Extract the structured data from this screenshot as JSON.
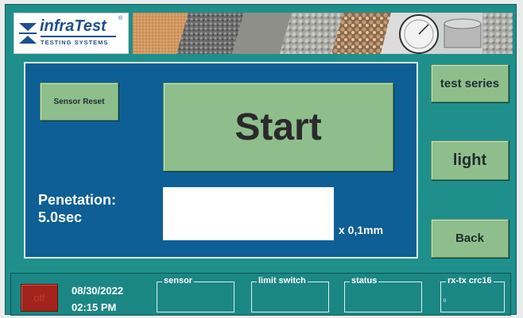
{
  "header": {
    "logo_name": "infraTest",
    "logo_registered": "®",
    "logo_tagline": "TESTING SYSTEMS"
  },
  "main": {
    "sensor_reset_label": "Sensor Reset",
    "start_label": "Start",
    "penetration_label": "Penetation:",
    "penetration_value": "5.0sec",
    "value_field": "",
    "unit_label": "x 0,1mm"
  },
  "side": {
    "test_series_label": "test series",
    "light_label": "light",
    "back_label": "Back"
  },
  "status_bar": {
    "off_label": "off",
    "date": "08/30/2022",
    "time": "02:15 PM",
    "groups": [
      {
        "label": "sensor",
        "value": ""
      },
      {
        "label": "limit switch",
        "value": ""
      },
      {
        "label": "status",
        "value": ""
      },
      {
        "label": "rx-tx crc16",
        "value": "0"
      }
    ]
  },
  "colors": {
    "frame": "#1f8f8c",
    "panel": "#0d5f96",
    "button": "#8fbe8d",
    "off_button": "#a3221b",
    "logo_blue": "#1d4f91"
  }
}
